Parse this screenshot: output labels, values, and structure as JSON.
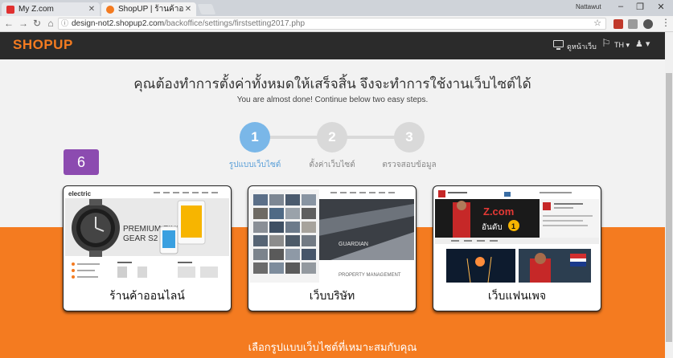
{
  "browser": {
    "tabs": [
      {
        "title": "My Z.com",
        "favicon_color": "#e03030"
      },
      {
        "title": "ShopUP | ร้านค้าออนไลน์ครบ",
        "favicon_color": "#f47b20"
      }
    ],
    "profile": "Nattawut",
    "url_host": "design-not2.shopup2.com",
    "url_path": "/backoffice/settings/firstsetting2017.php"
  },
  "header": {
    "logo": "SHOPUP",
    "view_site": "ดูหน้าเว็บ",
    "language": "TH"
  },
  "main": {
    "headline": "คุณต้องทำการตั้งค่าทั้งหมดให้เสร็จสิ้น จึงจะทำการใช้งานเว็บไซต์ได้",
    "subline": "You are almost done! Continue below two easy steps.",
    "steps": [
      {
        "number": "1",
        "label": "รูปแบบเว็บไซต์",
        "active": true
      },
      {
        "number": "2",
        "label": "ตั้งค่าเว็บไซต์",
        "active": false
      },
      {
        "number": "3",
        "label": "ตรวจสอบข้อมูล",
        "active": false
      }
    ],
    "badge": "6",
    "cards": [
      {
        "caption": "ร้านค้าออนไลน์",
        "brand": "electric",
        "promo_line1": "PREMIUM FINISHI",
        "promo_line2": "GEAR S2 DIA"
      },
      {
        "caption": "เว็บบริษัท",
        "brand": "GUARDIAN",
        "promo_line1": "PROPERTY MANAGEMENT"
      },
      {
        "caption": "เว็บแฟนเพจ",
        "brand": "Z.com",
        "promo_line1": "อันดับ",
        "promo_number": "1"
      }
    ],
    "bottom_note": "เลือกรูปแบบเว็บไซต์ที่เหมาะสมกับคุณ"
  },
  "colors": {
    "accent_orange": "#f47b20",
    "step_active": "#7ab7e8",
    "step_inactive": "#d9d9d9",
    "badge_purple": "#8c4bb0",
    "header_dark": "#2b2b2b"
  }
}
